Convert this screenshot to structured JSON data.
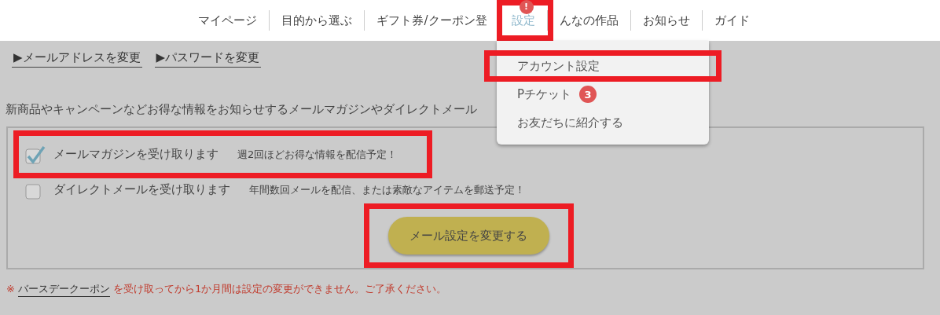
{
  "nav": {
    "items": [
      {
        "label": "マイページ",
        "selected": false,
        "highlighted": false
      },
      {
        "label": "目的から選ぶ",
        "selected": false,
        "highlighted": false
      },
      {
        "label": "ギフト券/クーポン登",
        "selected": false,
        "highlighted": false
      },
      {
        "label": "設定",
        "selected": true,
        "highlighted": true,
        "badge": "!"
      },
      {
        "label": "んなの作品",
        "selected": false,
        "highlighted": false
      },
      {
        "label": "お知らせ",
        "selected": false,
        "highlighted": false
      },
      {
        "label": "ガイド",
        "selected": false,
        "highlighted": false
      }
    ]
  },
  "dropdown": {
    "items": [
      {
        "label": "アカウント設定",
        "highlighted": true
      },
      {
        "label": "Pチケット",
        "highlighted": false,
        "badge": "3"
      },
      {
        "label": "お友だちに紹介する",
        "highlighted": false
      }
    ]
  },
  "links": [
    "▶メールアドレスを変更",
    "▶パスワードを変更"
  ],
  "description": "新商品やキャンペーンなどお得な情報をお知らせするメールマガジンやダイレクトメール",
  "options": [
    {
      "label": "メールマガジンを受け取ります",
      "note": "週2回ほどお得な情報を配信予定！",
      "checked": true,
      "highlighted": true
    },
    {
      "label": "ダイレクトメールを受け取ります",
      "note": "年間数回メールを配信、または素敵なアイテムを郵送予定！",
      "checked": false,
      "highlighted": false
    }
  ],
  "submit": {
    "label": "メール設定を変更する",
    "highlighted": true
  },
  "notice": {
    "mark": "※",
    "link": "バースデークーポン",
    "text": "を受け取ってから1か月間は設定の変更ができません。ご了承ください。"
  }
}
